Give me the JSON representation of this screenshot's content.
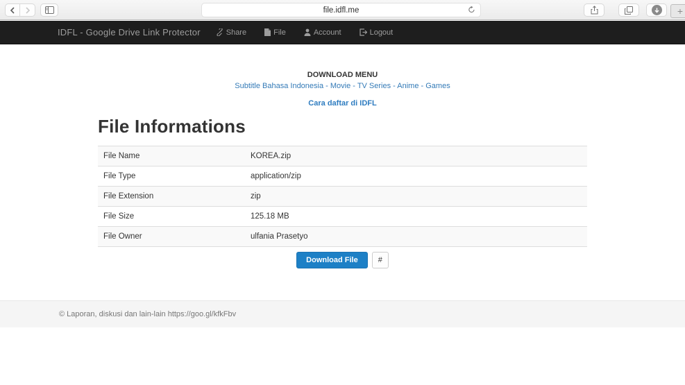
{
  "browser": {
    "url": "file.idfl.me",
    "new_tab_label": "+"
  },
  "navbar": {
    "brand": "IDFL - Google Drive Link Protector",
    "items": [
      {
        "label": "Share",
        "icon": "link-icon"
      },
      {
        "label": "File",
        "icon": "file-icon"
      },
      {
        "label": "Account",
        "icon": "user-icon"
      },
      {
        "label": "Logout",
        "icon": "logout-icon"
      }
    ]
  },
  "download_menu": {
    "title": "DOWNLOAD MENU",
    "links": [
      "Subtitle Bahasa Indonesia",
      "Movie",
      "TV Series",
      "Anime",
      "Games"
    ],
    "separator": " - ",
    "register_link": "Cara daftar di IDFL"
  },
  "file_info": {
    "heading": "File Informations",
    "rows": [
      {
        "label": "File Name",
        "value": "KOREA.zip"
      },
      {
        "label": "File Type",
        "value": "application/zip"
      },
      {
        "label": "File Extension",
        "value": "zip"
      },
      {
        "label": "File Size",
        "value": "125.18 MB"
      },
      {
        "label": "File Owner",
        "value": "ulfania Prasetyo"
      }
    ],
    "download_button": "Download File",
    "hash_button": "#"
  },
  "footer": {
    "text": "© Laporan, diskusi dan lain-lain https://goo.gl/kfkFbv"
  },
  "colors": {
    "accent_blue": "#1d80c6",
    "link_blue": "#337ab7",
    "navbar_bg": "#1e1e1e",
    "navbar_text": "#9d9d9d",
    "footer_bg": "#f5f5f5"
  }
}
